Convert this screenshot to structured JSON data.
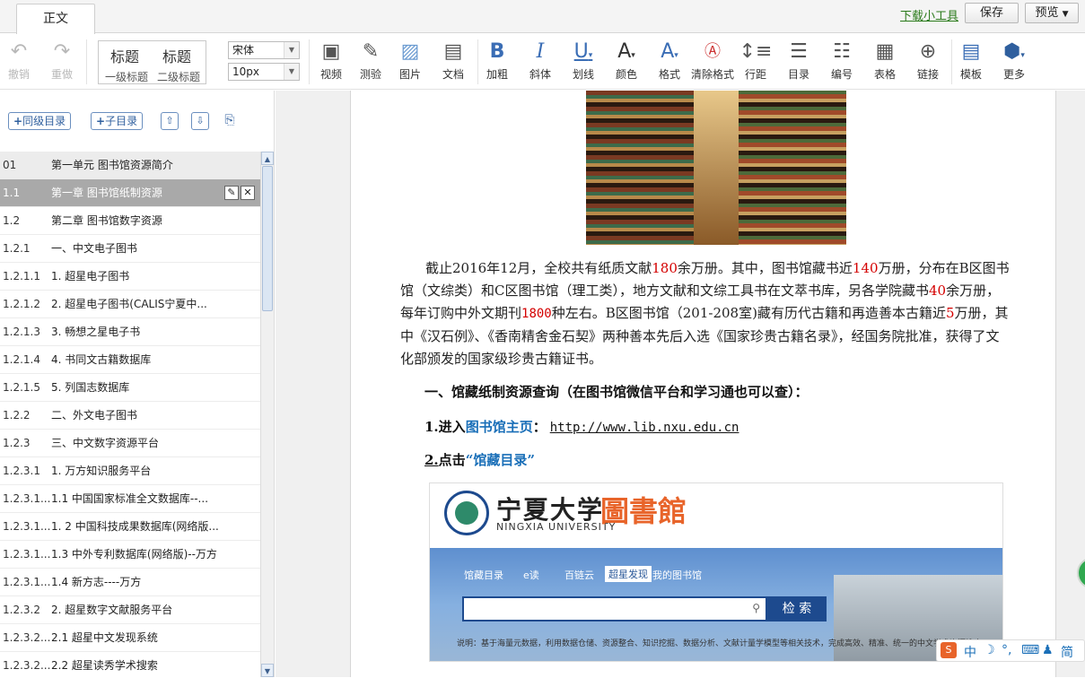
{
  "tabs": {
    "active": "正文"
  },
  "topbar": {
    "download_tool": "下载小工具",
    "save": "保存",
    "preview": "预览"
  },
  "toolbar": {
    "undo": "撤销",
    "redo": "重做",
    "heading1": "标题",
    "heading2": "标题",
    "heading1_sub": "一级标题",
    "heading2_sub": "二级标题",
    "font_family": "宋体",
    "font_size": "10px",
    "video": "视频",
    "quiz": "测验",
    "image": "图片",
    "document": "文档",
    "bold": "加粗",
    "italic": "斜体",
    "underline": "划线",
    "color": "颜色",
    "format": "格式",
    "clear_format": "清除格式",
    "line_spacing": "行距",
    "toc": "目录",
    "numbering": "编号",
    "table": "表格",
    "link": "链接",
    "template": "模板",
    "more": "更多"
  },
  "outline": {
    "add_sibling": "同级目录",
    "add_child": "子目录",
    "items": [
      {
        "num": "01",
        "title": "第一单元 图书馆资源简介"
      },
      {
        "num": "1.1",
        "title": "第一章 图书馆纸制资源"
      },
      {
        "num": "1.2",
        "title": "第二章 图书馆数字资源"
      },
      {
        "num": "1.2.1",
        "title": "一、中文电子图书"
      },
      {
        "num": "1.2.1.1",
        "title": "1. 超星电子图书"
      },
      {
        "num": "1.2.1.2",
        "title": "2. 超星电子图书(CALIS宁夏中..."
      },
      {
        "num": "1.2.1.3",
        "title": "3. 畅想之星电子书"
      },
      {
        "num": "1.2.1.4",
        "title": "4. 书同文古籍数据库"
      },
      {
        "num": "1.2.1.5",
        "title": "5. 列国志数据库"
      },
      {
        "num": "1.2.2",
        "title": "二、外文电子图书"
      },
      {
        "num": "1.2.3",
        "title": "三、中文数字资源平台"
      },
      {
        "num": "1.2.3.1",
        "title": "1. 万方知识服务平台"
      },
      {
        "num": "1.2.3.1...",
        "title": "1.1 中国国家标准全文数据库--..."
      },
      {
        "num": "1.2.3.1...",
        "title": "1. 2 中国科技成果数据库(网络版..."
      },
      {
        "num": "1.2.3.1...",
        "title": "1.3 中外专利数据库(网络版)--万方"
      },
      {
        "num": "1.2.3.1...",
        "title": "1.4 新方志----万方"
      },
      {
        "num": "1.2.3.2",
        "title": "2. 超星数字文献服务平台"
      },
      {
        "num": "1.2.3.2...",
        "title": "2.1 超星中文发现系统"
      },
      {
        "num": "1.2.3.2...",
        "title": "2.2 超星读秀学术搜索"
      }
    ]
  },
  "content": {
    "p1_a": "截止2016年12月，全校共有纸质文献",
    "p1_n1": "180",
    "p1_b": "余万册。其中，图书馆藏书近",
    "p1_n2": "140",
    "p1_c": "万册，分布在B区图书馆（文综类）和C区图书馆（理工类），地方文献和文综工具书在文萃书库，另各学院藏书",
    "p1_n3": "40",
    "p1_d": "余万册，每年订购中外文期刊",
    "p1_n4": "1800",
    "p1_e": "种左右。B区图书馆（201-208室)藏有历代古籍和再造善本古籍近",
    "p1_n5": "5",
    "p1_f": "万册，其中《汉石例》、《香南精舍金石契》两种善本先后入选《国家珍贵古籍名录》，经国务院批准，获得了文化部颁发的国家级珍贵古籍证书。",
    "heading": "一、馆藏纸制资源查询（在图书馆微信平台和学习通也可以查）：",
    "step1_num": "1.",
    "step1_a": "进入",
    "step1_link": "图书馆主页",
    "step1_colon": "：",
    "step1_url": "http://www.lib.nxu.edu.cn",
    "step2_num": "2.",
    "step2_a": "点击",
    "step2_link": "“馆藏目录”",
    "embed": {
      "logo_cn": "宁夏大学",
      "logo_en": "NINGXIA UNIVERSITY",
      "logo_lib": "圖書館",
      "nav": [
        "馆藏目录",
        "e读",
        "百链云",
        "超星发现",
        "我的图书馆"
      ],
      "search_btn": "检 索",
      "note": "说明：基于海量元数据，利用数据仓储、资源整合、知识挖掘、数据分析、文献计量学模型等相关技术，完成高效、精准、统一的中文学术资源搜索"
    }
  },
  "ime": {
    "items": [
      "中",
      "简"
    ]
  }
}
